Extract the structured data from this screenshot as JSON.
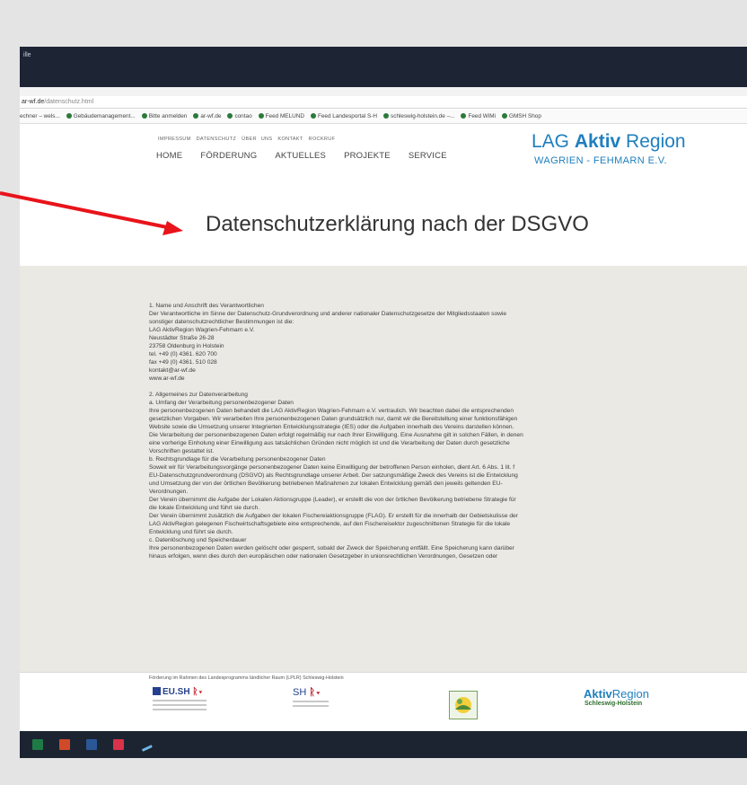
{
  "window": {
    "title": "ille"
  },
  "addressbar": {
    "domain": "ar-wf.de",
    "path": "/datenschutz.html"
  },
  "bookmarks": [
    "echner – wels...",
    "Gebäudemanagement...",
    "Bitte anmelden",
    "ar-wf.de",
    "contao",
    "Feed MELUND",
    "Feed Landesportal S-H",
    "schleswig-holstein.de –...",
    "Feed WiMi",
    "GMSH Shop"
  ],
  "site": {
    "topnav": [
      "IMPRESSUM",
      "DATENSCHUTZ",
      "ÜBER UNS",
      "KONTAKT",
      "ROCKRUF"
    ],
    "mainnav": [
      "HOME",
      "FÖRDERUNG",
      "AKTUELLES",
      "PROJEKTE",
      "SERVICE"
    ],
    "logo": {
      "prefix": "LAG ",
      "bold": "Aktiv",
      "suffix": " Region",
      "line2": "WAGRIEN - FEHMARN E.V."
    }
  },
  "page_title": "Datenschutzerklärung nach der DSGVO",
  "doc": {
    "block1": [
      "1.   Name und Anschrift des Verantwortlichen",
      "Der Verantwortliche im Sinne der Datenschutz-Grundverordnung und anderer nationaler Datenschutzgesetze der Mitgliedsstaaten sowie",
      "sonstiger datenschutzrechtlicher Bestimmungen ist die:",
      "LAG AktivRegion Wagrien-Fehmarn e.V.",
      "Neustädter Straße 26-28",
      "23758 Oldenburg in Holstein",
      "tel. +49 (0) 4361. 620 700",
      "fax +49 (0) 4361. 510 028",
      "kontakt@ar-wf.de",
      "www.ar-wf.de"
    ],
    "block2": [
      "2.   Allgemeines zur Datenverarbeitung",
      "a.   Umfang der Verarbeitung personenbezogener Daten",
      "Ihre personenbezogenen Daten behandelt die LAG AktivRegion Wagrien-Fehmarn e.V. vertraulich. Wir beachten dabei die entsprechenden",
      "gesetzlichen Vorgaben. Wir verarbeiten Ihre personenbezogenen Daten grundsätzlich nur, damit wir die Bereitstellung einer funktionsfähigen",
      "Website sowie die Umsetzung unserer Integrierten Entwicklungsstrategie (IES) oder die Aufgaben innerhalb des Vereins darstellen können.",
      "Die Verarbeitung der personenbezogenen Daten erfolgt regelmäßig nur nach Ihrer Einwilligung. Eine Ausnahme gilt in solchen Fällen, in denen",
      "eine vorherige Einholung einer Einwilligung aus tatsächlichen Gründen nicht möglich ist und die Verarbeitung der Daten durch gesetzliche",
      "Vorschriften gestattet ist.",
      "b.   Rechtsgrundlage für die Verarbeitung personenbezogener Daten",
      "Soweit wir für Verarbeitungsvorgänge personenbezogener Daten keine Einwilligung der betroffenen Person einholen, dient Art. 6 Abs. 1 lit. f",
      "EU-Datenschutzgrundverordnung (DSGVO) als Rechtsgrundlage unserer Arbeit.  Der satzungsmäßige Zweck des Vereins ist die Entwicklung",
      "und Umsetzung der von der örtlichen Bevölkerung betriebenen Maßnahmen zur lokalen Entwicklung gemäß den jeweils geltenden EU-",
      "Verordnungen.",
      "Der Verein übernimmt die Aufgabe der Lokalen Aktionsgruppe (Leader), er erstellt die von der örtlichen Bevölkerung betriebene Strategie für",
      "die lokale Entwicklung und führt sie durch.",
      "Der Verein übernimmt zusätzlich die Aufgaben der lokalen Fischereiaktionsgruppe (FLAG). Er erstellt für die innerhalb der Gebietskulisse der",
      "LAG AktivRegion gelegenen Fischwirtschaftsgebiete eine entsprechende, auf den Fischereisektor zugeschnittenen Strategie für die lokale",
      "Entwicklung und führt sie durch.",
      "c.   Datenlöschung und Speicherdauer",
      "Ihre personenbezogenen Daten werden gelöscht oder gesperrt, sobald der Zweck der Speicherung entfällt. Eine Speicherung kann darüber",
      "hinaus erfolgen, wenn dies durch den europäischen oder nationalen Gesetzgeber in unionsrechtlichen Verordnungen, Gesetzen oder"
    ]
  },
  "footer": {
    "note": "Förderung im Rahmen des Landesprogramms ländlicher Raum (LPLR) Schleswig-Holstein",
    "eu_logo": "EU.SH",
    "sh_logo": "SH",
    "aktiv_logo_bold": "Aktiv",
    "aktiv_logo_rest": "Region",
    "aktiv_logo_sub": "Schleswig-Holstein"
  },
  "colors": {
    "arrow": "#e8141b",
    "logo_blue": "#1f7fbe",
    "content_bg": "#ebe9e4",
    "titlebar": "#1d2434"
  },
  "taskbar_icons": [
    "excel-icon",
    "powerpoint-icon",
    "word-icon",
    "xmind-icon",
    "pen-tool-icon"
  ]
}
